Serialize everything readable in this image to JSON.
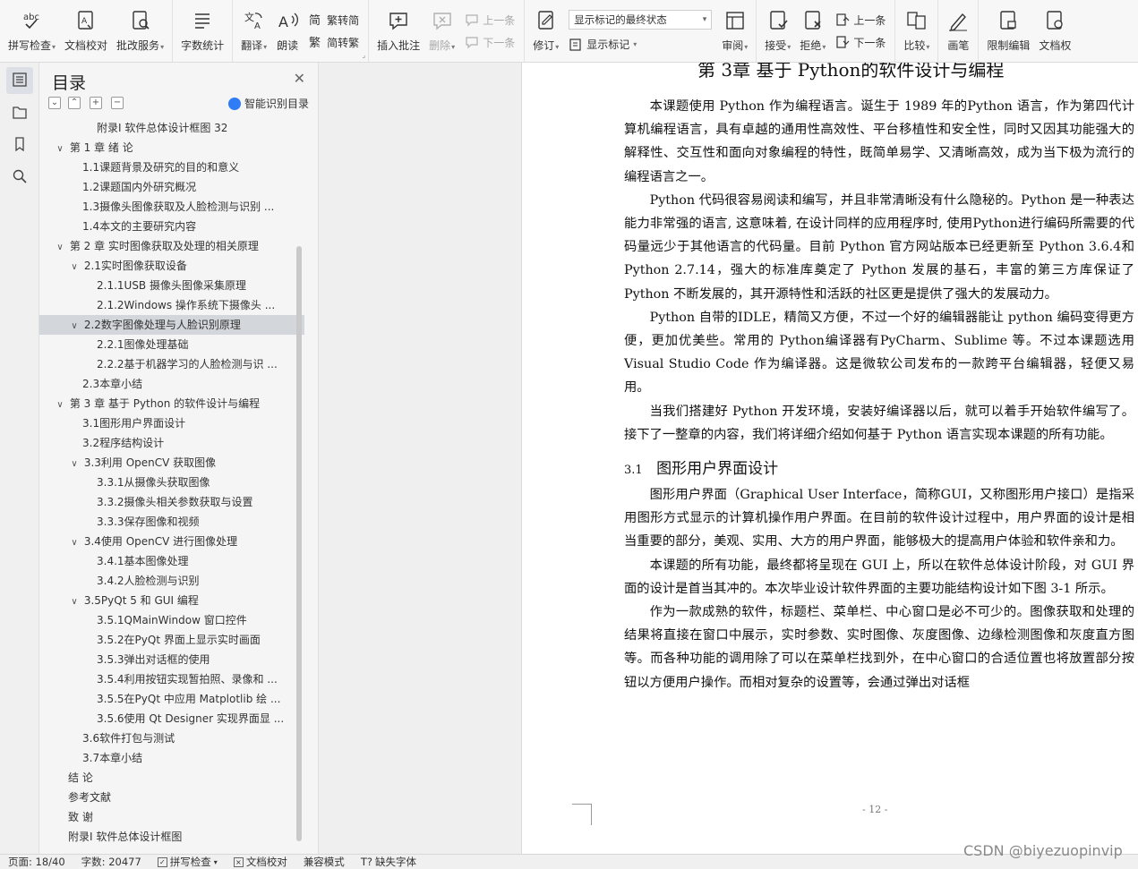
{
  "ribbon": {
    "spell_check": "拼写检查",
    "doc_proof": "文档校对",
    "annotate_service": "批改服务",
    "word_count": "字数统计",
    "translate": "翻译",
    "read_aloud": "朗读",
    "trad_convert": "繁转简",
    "simp_convert": "简转繁",
    "insert_comment": "插入批注",
    "delete": "删除",
    "prev_comment": "上一条",
    "next_comment": "下一条",
    "track_changes": "修订",
    "markup_state": "显示标记的最终状态",
    "show_markup": "显示标记",
    "review": "审阅",
    "accept": "接受",
    "reject": "拒绝",
    "prev_change": "上一条",
    "next_change": "下一条",
    "compare": "比较",
    "pen": "画笔",
    "restrict_edit": "限制编辑",
    "doc_rights": "文档权"
  },
  "toc": {
    "title": "目录",
    "smart_label": "智能识别目录",
    "items": [
      {
        "text": "附录I 软件总体设计框图 32",
        "level": 3,
        "caret": ""
      },
      {
        "text": "第 1 章  绪  论",
        "level": 1,
        "caret": "∨"
      },
      {
        "text": "1.1课题背景及研究的目的和意义",
        "level": 2,
        "caret": ""
      },
      {
        "text": "1.2课题国内外研究概况",
        "level": 2,
        "caret": ""
      },
      {
        "text": "1.3摄像头图像获取及人脸检测与识别 ...",
        "level": 2,
        "caret": ""
      },
      {
        "text": "1.4本文的主要研究内容",
        "level": 2,
        "caret": ""
      },
      {
        "text": "第 2 章 实时图像获取及处理的相关原理",
        "level": 1,
        "caret": "∨"
      },
      {
        "text": "2.1实时图像获取设备",
        "level": 2,
        "caret": "∨"
      },
      {
        "text": "2.1.1USB 摄像头图像采集原理",
        "level": 3,
        "caret": ""
      },
      {
        "text": "2.1.2Windows 操作系统下摄像头 ...",
        "level": 3,
        "caret": ""
      },
      {
        "text": "2.2数字图像处理与人脸识别原理",
        "level": 2,
        "caret": "∨",
        "selected": true
      },
      {
        "text": "2.2.1图像处理基础",
        "level": 3,
        "caret": ""
      },
      {
        "text": "2.2.2基于机器学习的人脸检测与识 ...",
        "level": 3,
        "caret": ""
      },
      {
        "text": "2.3本章小结",
        "level": 2,
        "caret": ""
      },
      {
        "text": "第 3 章  基于 Python 的软件设计与编程",
        "level": 1,
        "caret": "∨"
      },
      {
        "text": "3.1图形用户界面设计",
        "level": 2,
        "caret": ""
      },
      {
        "text": "3.2程序结构设计",
        "level": 2,
        "caret": ""
      },
      {
        "text": "3.3利用 OpenCV 获取图像",
        "level": 2,
        "caret": "∨"
      },
      {
        "text": "3.3.1从摄像头获取图像",
        "level": 3,
        "caret": ""
      },
      {
        "text": "3.3.2摄像头相关参数获取与设置",
        "level": 3,
        "caret": ""
      },
      {
        "text": "3.3.3保存图像和视频",
        "level": 3,
        "caret": ""
      },
      {
        "text": "3.4使用 OpenCV 进行图像处理",
        "level": 2,
        "caret": "∨"
      },
      {
        "text": "3.4.1基本图像处理",
        "level": 3,
        "caret": ""
      },
      {
        "text": "3.4.2人脸检测与识别",
        "level": 3,
        "caret": ""
      },
      {
        "text": "3.5PyQt 5 和 GUI 编程",
        "level": 2,
        "caret": "∨"
      },
      {
        "text": "3.5.1QMainWindow 窗口控件",
        "level": 3,
        "caret": ""
      },
      {
        "text": "3.5.2在PyQt 界面上显示实时画面",
        "level": 3,
        "caret": ""
      },
      {
        "text": "3.5.3弹出对话框的使用",
        "level": 3,
        "caret": ""
      },
      {
        "text": "3.5.4利用按钮实现暂拍照、录像和 ...",
        "level": 3,
        "caret": ""
      },
      {
        "text": "3.5.5在PyQt 中应用 Matplotlib 绘 ...",
        "level": 3,
        "caret": ""
      },
      {
        "text": "3.5.6使用 Qt Designer 实现界面显 ...",
        "level": 3,
        "caret": ""
      },
      {
        "text": "3.6软件打包与测试",
        "level": 2,
        "caret": ""
      },
      {
        "text": "3.7本章小结",
        "level": 2,
        "caret": ""
      },
      {
        "text": "结  论",
        "level": 1,
        "caret": ""
      },
      {
        "text": "参考文献",
        "level": 1,
        "caret": ""
      },
      {
        "text": "致  谢",
        "level": 1,
        "caret": ""
      },
      {
        "text": "附录I  软件总体设计框图",
        "level": 1,
        "caret": ""
      }
    ]
  },
  "document": {
    "heading": "第 3章 基于 Python的软件设计与编程",
    "paragraphs_a": [
      "本课题使用 Python 作为编程语言。诞生于 1989 年的Python 语言，作为第四代计算机编程语言，具有卓越的通用性高效性、平台移植性和安全性，同时又因其功能强大的解释性、交互性和面向对象编程的特性，既简单易学、又清晰高效，成为当下极为流行的编程语言之一。",
      "Python 代码很容易阅读和编写，并且非常清晰没有什么隐秘的。Python 是一种表达能力非常强的语言, 这意味着, 在设计同样的应用程序时, 使用Python进行编码所需要的代码量远少于其他语言的代码量。目前 Python 官方网站版本已经更新至 Python 3.6.4和Python 2.7.14，强大的标准库奠定了 Python 发展的基石，丰富的第三方库保证了 Python 不断发展的，其开源特性和活跃的社区更是提供了强大的发展动力。",
      "Python 自带的IDLE，精简又方便，不过一个好的编辑器能让 python 编码变得更方便，更加优美些。常用的 Python编译器有PyCharm、Sublime 等。不过本课题选用 Visual Studio Code 作为编译器。这是微软公司发布的一款跨平台编辑器，轻便又易用。",
      "当我们搭建好 Python 开发环境，安装好编译器以后，就可以着手开始软件编写了。接下了一整章的内容，我们将详细介绍如何基于 Python 语言实现本课题的所有功能。"
    ],
    "section_num": "3.1",
    "section_title": "图形用户界面设计",
    "paragraphs_b": [
      "图形用户界面（Graphical User Interface，简称GUI，又称图形用户接口）是指采用图形方式显示的计算机操作用户界面。在目前的软件设计过程中，用户界面的设计是相当重要的部分，美观、实用、大方的用户界面，能够极大的提高用户体验和软件亲和力。",
      "本课题的所有功能，最终都将呈现在 GUI 上，所以在软件总体设计阶段，对 GUI 界面的设计是首当其冲的。本次毕业设计软件界面的主要功能结构设计如下图 3-1 所示。",
      "作为一款成熟的软件，标题栏、菜单栏、中心窗口是必不可少的。图像获取和处理的结果将直接在窗口中展示，实时参数、实时图像、灰度图像、边缘检测图像和灰度直方图等。而各种功能的调用除了可以在菜单栏找到外，在中心窗口的合适位置也将放置部分按钮以方便用户操作。而相对复杂的设置等，会通过弹出对话框"
    ],
    "page_number": "- 12 -"
  },
  "status": {
    "page": "页面: 18/40",
    "words": "字数: 20477",
    "spell": "拼写检查",
    "proof": "文档校对",
    "compat": "兼容模式",
    "missing_font": "缺失字体"
  },
  "watermark": "CSDN @biyezuopinvip"
}
